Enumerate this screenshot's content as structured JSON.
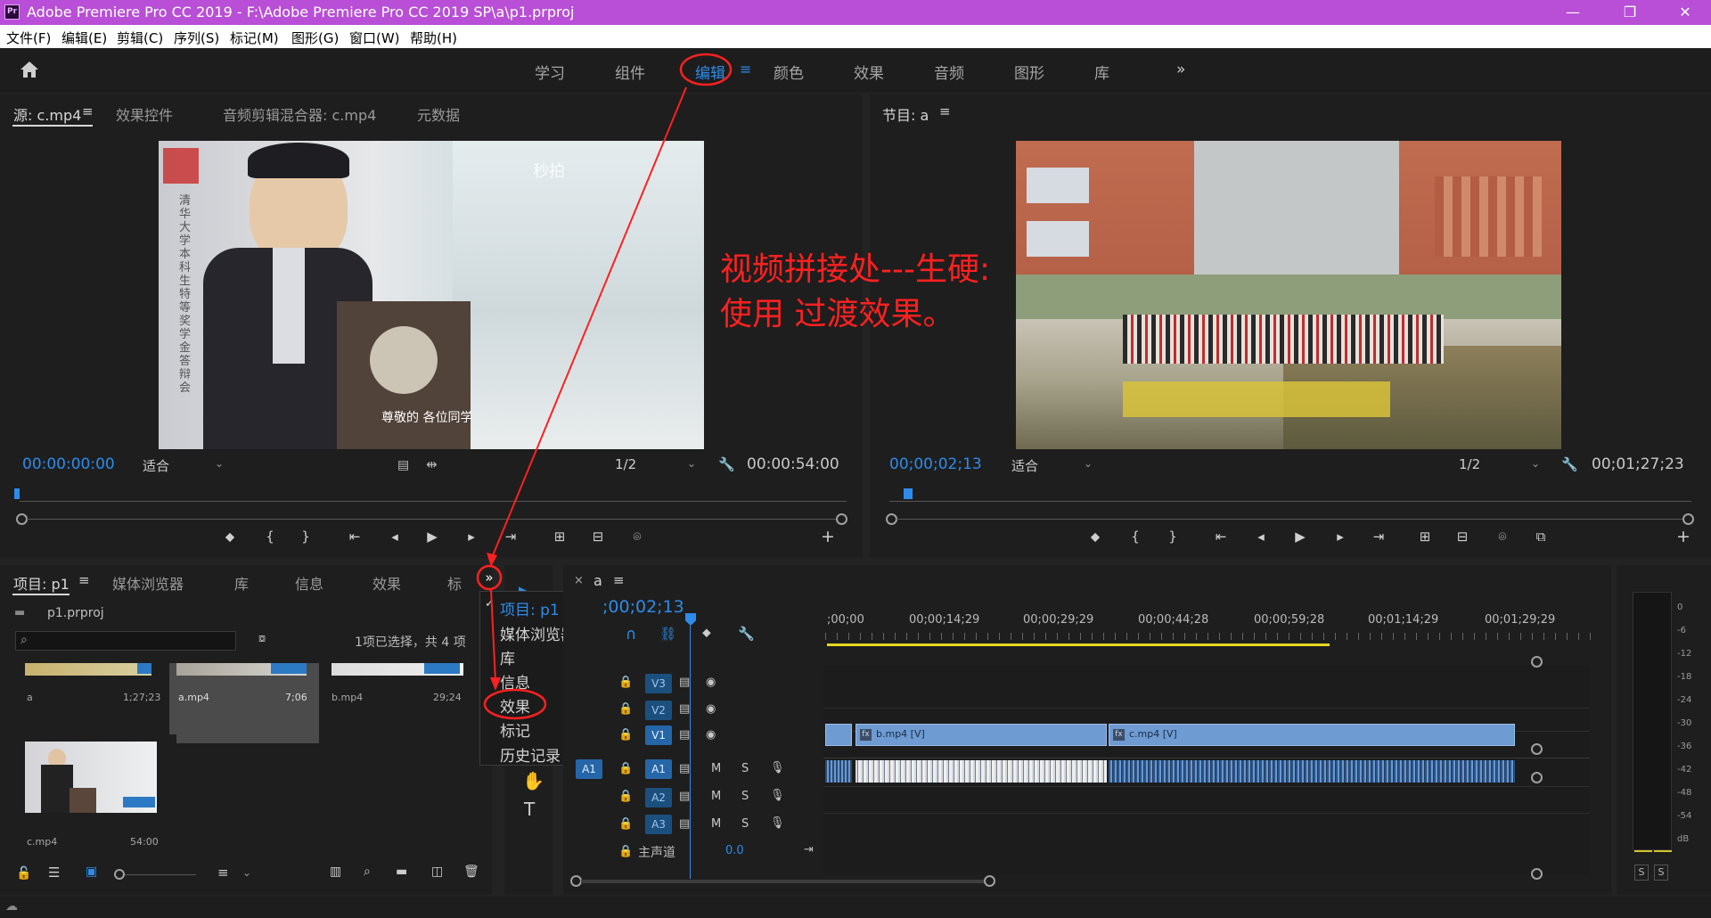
{
  "window": {
    "title": "Adobe Premiere Pro CC 2019 - F:\\Adobe Premiere Pro CC 2019 SP\\a\\p1.prproj",
    "app_icon": "Pr",
    "minimize": "—",
    "maximize": "❐",
    "close": "✕"
  },
  "menu": [
    "文件(F)",
    "编辑(E)",
    "剪辑(C)",
    "序列(S)",
    "标记(M)",
    "图形(G)",
    "窗口(W)",
    "帮助(H)"
  ],
  "workspaces": {
    "tabs": [
      "学习",
      "组件",
      "编辑",
      "颜色",
      "效果",
      "音频",
      "图形",
      "库"
    ],
    "active": "编辑",
    "more": "»"
  },
  "source": {
    "tabs": [
      "源: c.mp4",
      "效果控件",
      "音频剪辑混合器: c.mp4",
      "元数据"
    ],
    "timecode": "00:00:00:00",
    "fit": "适合",
    "resolution": "1/2",
    "duration": "00:00:54:00",
    "watermark": "秒拍",
    "seal": "清华大学本科生特等奖学金答辩会",
    "caption": "尊敬的 各位同学"
  },
  "program": {
    "tab": "节目: a",
    "timecode": "00;00;02;13",
    "fit": "适合",
    "resolution": "1/2",
    "duration": "00;01;27;23"
  },
  "annotation": {
    "line1": "视频拼接处---生硬:",
    "line2": "使用 过渡效果。"
  },
  "project": {
    "tabs": [
      "项目: p1",
      "媒体浏览器",
      "库",
      "信息",
      "效果",
      "标"
    ],
    "file": "p1.prproj",
    "selection": "1项已选择，共 4 项",
    "items": [
      {
        "name": "a",
        "duration": "1;27;23"
      },
      {
        "name": "a.mp4",
        "duration": "7;06"
      },
      {
        "name": "b.mp4",
        "duration": "29;24"
      },
      {
        "name": "c.mp4",
        "duration": "54:00"
      }
    ]
  },
  "popup": {
    "items": [
      "项目: p1",
      "媒体浏览器",
      "库",
      "信息",
      "效果",
      "标记",
      "历史记录"
    ],
    "checked": "项目: p1"
  },
  "timeline": {
    "tab": "a",
    "timecode": ";00;02;13",
    "ruler": [
      ";00;00",
      "00;00;14;29",
      "00;00;29;29",
      "00;00;44;28",
      "00;00;59;28",
      "00;01;14;29",
      "00;01;29;29"
    ],
    "tracks_video": [
      "V3",
      "V2",
      "V1"
    ],
    "tracks_audio": [
      "A1",
      "A2",
      "A3"
    ],
    "source_patch": "A1",
    "master_label": "主声道",
    "master_value": "0.0",
    "clips": [
      {
        "name": "b.mp4 [V]"
      },
      {
        "name": "c.mp4 [V]"
      }
    ],
    "m": "M",
    "s": "S"
  },
  "meter": {
    "labels": [
      "0",
      "-6",
      "-12",
      "-18",
      "-24",
      "-30",
      "-36",
      "-42",
      "-48",
      "-54",
      "dB"
    ],
    "solo": [
      "S",
      "S"
    ]
  },
  "colors": {
    "accent": "#2d8ceb",
    "title_bar": "#b84fd6",
    "annotation": "#ff2020",
    "clip": "#6e9bd1",
    "work_area": "#e6d820"
  }
}
